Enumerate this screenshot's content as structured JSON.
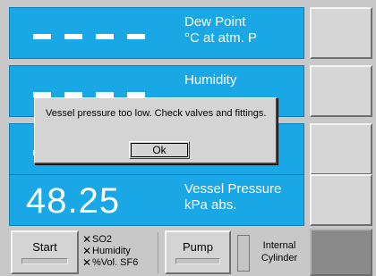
{
  "panels": [
    {
      "id": "dew-point",
      "value": "",
      "label_line1": "Dew Point",
      "label_line2": "°C at atm. P"
    },
    {
      "id": "humidity",
      "value": "",
      "label_line1": "Humidity",
      "label_line2": ""
    },
    {
      "id": "so2",
      "value": "",
      "label_line1": "",
      "label_line2": ""
    },
    {
      "id": "vessel-pressure",
      "value": "48.25",
      "label_line1": "Vessel Pressure",
      "label_line2": "kPa abs."
    }
  ],
  "bottom_bar": {
    "start_label": "Start",
    "gas_options": [
      "SO2",
      "Humidity",
      "%Vol. SF6"
    ],
    "pump_label": "Pump",
    "internal_line1": "Internal",
    "internal_line2": "Cylinder"
  },
  "dialog": {
    "message": "Vessel pressure too low. Check valves and fittings.",
    "ok_label": "Ok"
  },
  "colors": {
    "panel_blue": "#1aa7e6",
    "background": "#c8c8c8"
  },
  "icons": {
    "gas_option_mark": "✕"
  }
}
